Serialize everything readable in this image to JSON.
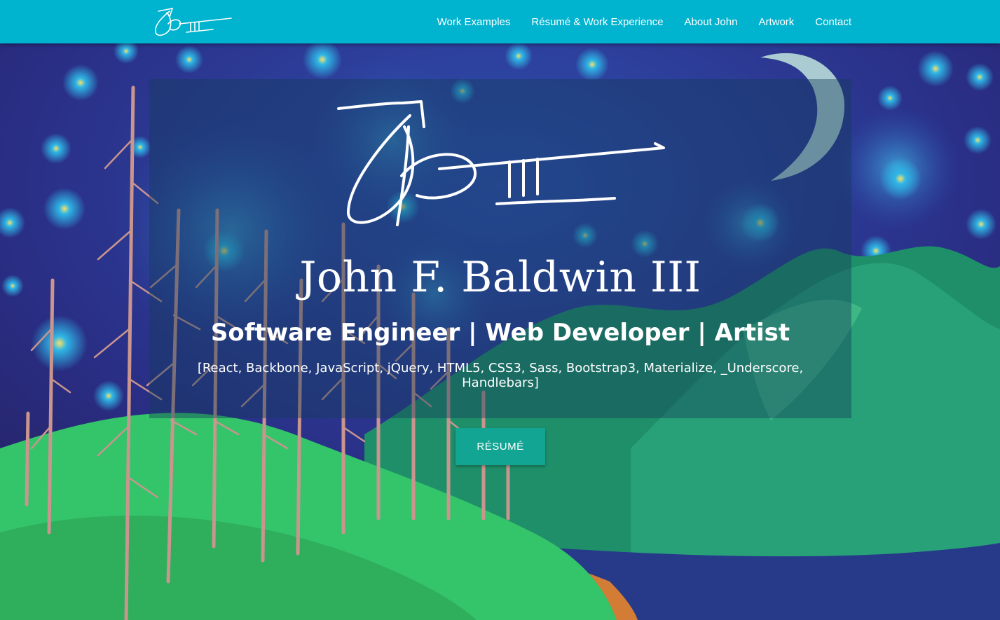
{
  "page": {
    "title": "John F. Baldwin III"
  },
  "colors": {
    "navbar": "#00b3cf",
    "button": "#12a594",
    "text": "#ffffff"
  },
  "nav": {
    "logo_icon": "signature-logo-icon",
    "links": [
      {
        "label": "Work Examples"
      },
      {
        "label": "Résumé & Work Experience"
      },
      {
        "label": "About John"
      },
      {
        "label": "Artwork"
      },
      {
        "label": "Contact"
      }
    ]
  },
  "hero": {
    "signature_icon": "signature-icon",
    "name": "John F. Baldwin III",
    "subtitle": "Software Engineer | Web Developer | Artist",
    "skills": "[React, Backbone, JavaScript, jQuery, HTML5, CSS3, Sass, Bootstrap3, Materialize, _Underscore, Handlebars]",
    "button_label": "RÉSUMÉ"
  },
  "background": {
    "description_icon": "landscape-painting-background"
  }
}
